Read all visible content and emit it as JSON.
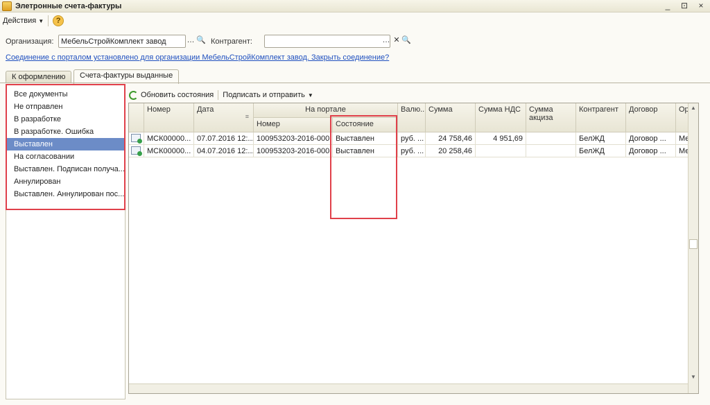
{
  "window": {
    "title": "Элетронные счета-фактуры",
    "controls": [
      "_",
      "⊡",
      "×"
    ]
  },
  "menubar": {
    "actions_label": "Действия",
    "help_label": "?"
  },
  "filters": {
    "org_label": "Организация:",
    "org_value": "МебельСтройКомплект завод",
    "counterparty_label": "Контрагент:",
    "counterparty_value": ""
  },
  "connection_link": "Соединение с порталом установлено для организации МебельСтройКомплект завод. Закрыть соединение?",
  "tabs": [
    {
      "label": "К оформлению"
    },
    {
      "label": "Счета-фактуры выданные"
    }
  ],
  "status_list": [
    "Все документы",
    "Не отправлен",
    "В разработке",
    "В разработке. Ошибка",
    "Выставлен",
    "На согласовании",
    "Выставлен. Подписан получа...",
    "Аннулирован",
    "Выставлен. Аннулирован пос..."
  ],
  "selected_status": "Выставлен",
  "toolbar": {
    "refresh_label": "Обновить состояния",
    "sign_send_label": "Подписать и отправить"
  },
  "table": {
    "headers": {
      "number": "Номер",
      "date": "Дата",
      "portal": "На портале",
      "portal_number": "Номер",
      "portal_state": "Состояние",
      "currency": "Валю...",
      "sum": "Сумма",
      "vat": "Сумма НДС",
      "excise": "Сумма акциза",
      "counterparty": "Контрагент",
      "contract": "Договор",
      "org": "Орг"
    },
    "rows": [
      {
        "number": "МСК00000...",
        "date": "07.07.2016 12:...",
        "portal_number": "100953203-2016-000...",
        "state": "Выставлен",
        "currency": "руб. ...",
        "sum": "24 758,46",
        "vat": "4 951,69",
        "excise": "",
        "counterparty": "БелЖД",
        "contract": "Договор ...",
        "org": "Ме"
      },
      {
        "number": "МСК00000...",
        "date": "04.07.2016 12:...",
        "portal_number": "100953203-2016-000...",
        "state": "Выставлен",
        "currency": "руб. ...",
        "sum": "20 258,46",
        "vat": "",
        "excise": "",
        "counterparty": "БелЖД",
        "contract": "Договор ...",
        "org": "Ме"
      }
    ]
  }
}
